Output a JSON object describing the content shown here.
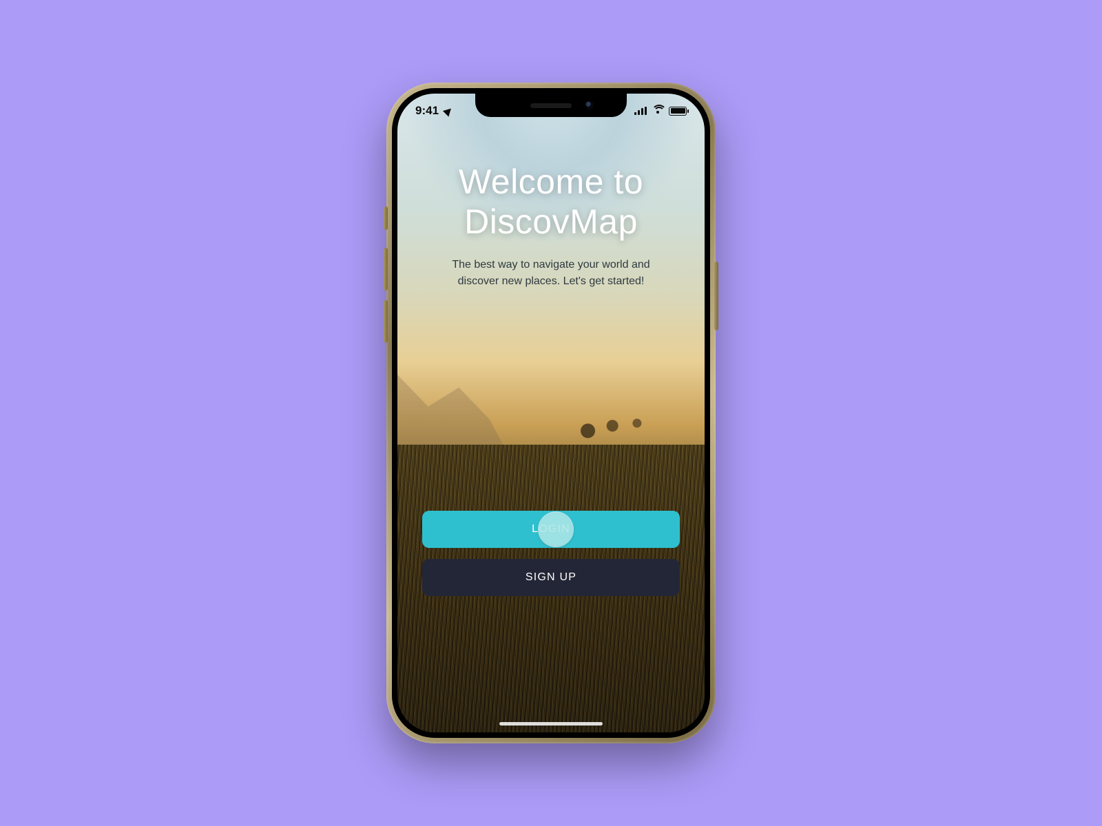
{
  "statusbar": {
    "time": "9:41",
    "location_icon": "location-arrow",
    "signal_bars": 4,
    "wifi": true,
    "battery_full": true
  },
  "welcome": {
    "title_line1": "Welcome to",
    "title_line2": "DiscovMap",
    "subtitle": "The best way to navigate your world and discover new places. Let's get started!"
  },
  "buttons": {
    "login_label": "LOGIN",
    "signup_label": "SIGN UP"
  },
  "colors": {
    "page_bg": "#ac9bf7",
    "login_btn": "#2fc0cf",
    "signup_btn": "#232636"
  }
}
